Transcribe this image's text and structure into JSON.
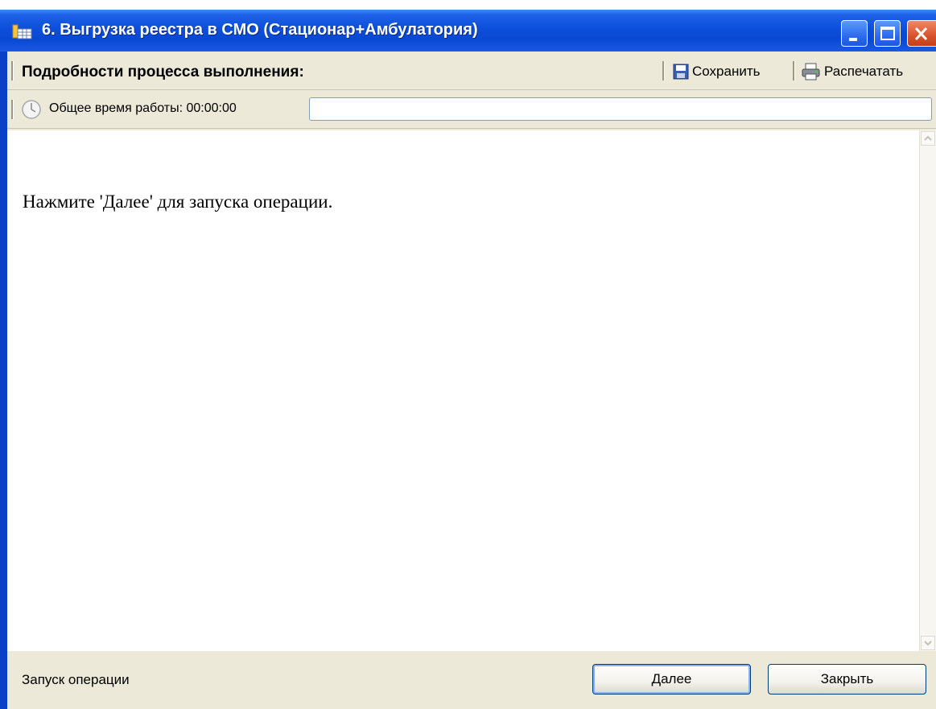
{
  "window": {
    "title": "6. Выгрузка реестра в СМО (Стационар+Амбулатория)",
    "title_icon": "folder-grid-icon",
    "controls": {
      "minimize_icon": "minimize-icon",
      "maximize_icon": "maximize-icon",
      "close_icon": "close-icon"
    },
    "colors": {
      "titlebar": "#0a48d2",
      "close": "#d9532c",
      "client": "#ece9d8"
    }
  },
  "toolbar": {
    "details_label": "Подробности процесса выполнения:",
    "save": {
      "label": "Сохранить",
      "icon": "save-icon"
    },
    "print": {
      "label": "Распечатать",
      "icon": "printer-icon"
    }
  },
  "timebar": {
    "icon": "clock-icon",
    "label": "Общее время работы: 00:00:00",
    "field_value": ""
  },
  "content": {
    "message": "Нажмите 'Далее' для запуска операции."
  },
  "footer": {
    "status": "Запуск операции",
    "next_label": "Далее",
    "close_label": "Закрыть"
  }
}
